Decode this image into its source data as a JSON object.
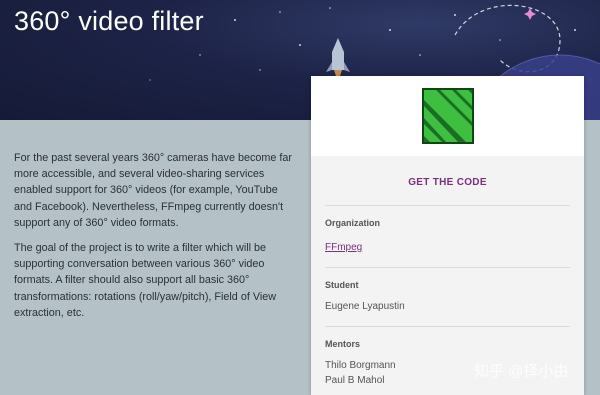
{
  "header": {
    "title": "360° video filter"
  },
  "description": {
    "paragraphs": [
      "For the past several years 360° cameras have become far more accessible, and several video-sharing services enabled support for 360° videos (for example, YouTube and Facebook). Nevertheless, FFmpeg currently doesn't support any of 360° video formats.",
      "The goal of the project is to write a filter which will be supporting conversation between various 360° video formats. A filter should also support all basic 360° transformations: rotations (roll/yaw/pitch), Field of View extraction, etc."
    ]
  },
  "card": {
    "logo_icon": "ffmpeg-logo-icon",
    "get_code_label": "GET THE CODE",
    "organization_label": "Organization",
    "organization_value": "FFmpeg",
    "student_label": "Student",
    "student_value": "Eugene Lyapustin",
    "mentors_label": "Mentors",
    "mentors": [
      "Thilo Borgmann",
      "Paul B Mahol"
    ]
  },
  "watermark": "知乎 @择小由",
  "colors": {
    "accent": "#7b2f7d",
    "hero_bg": "#1d2347",
    "content_bg": "#b4c2c8",
    "logo_green": "#1f8a2e"
  }
}
